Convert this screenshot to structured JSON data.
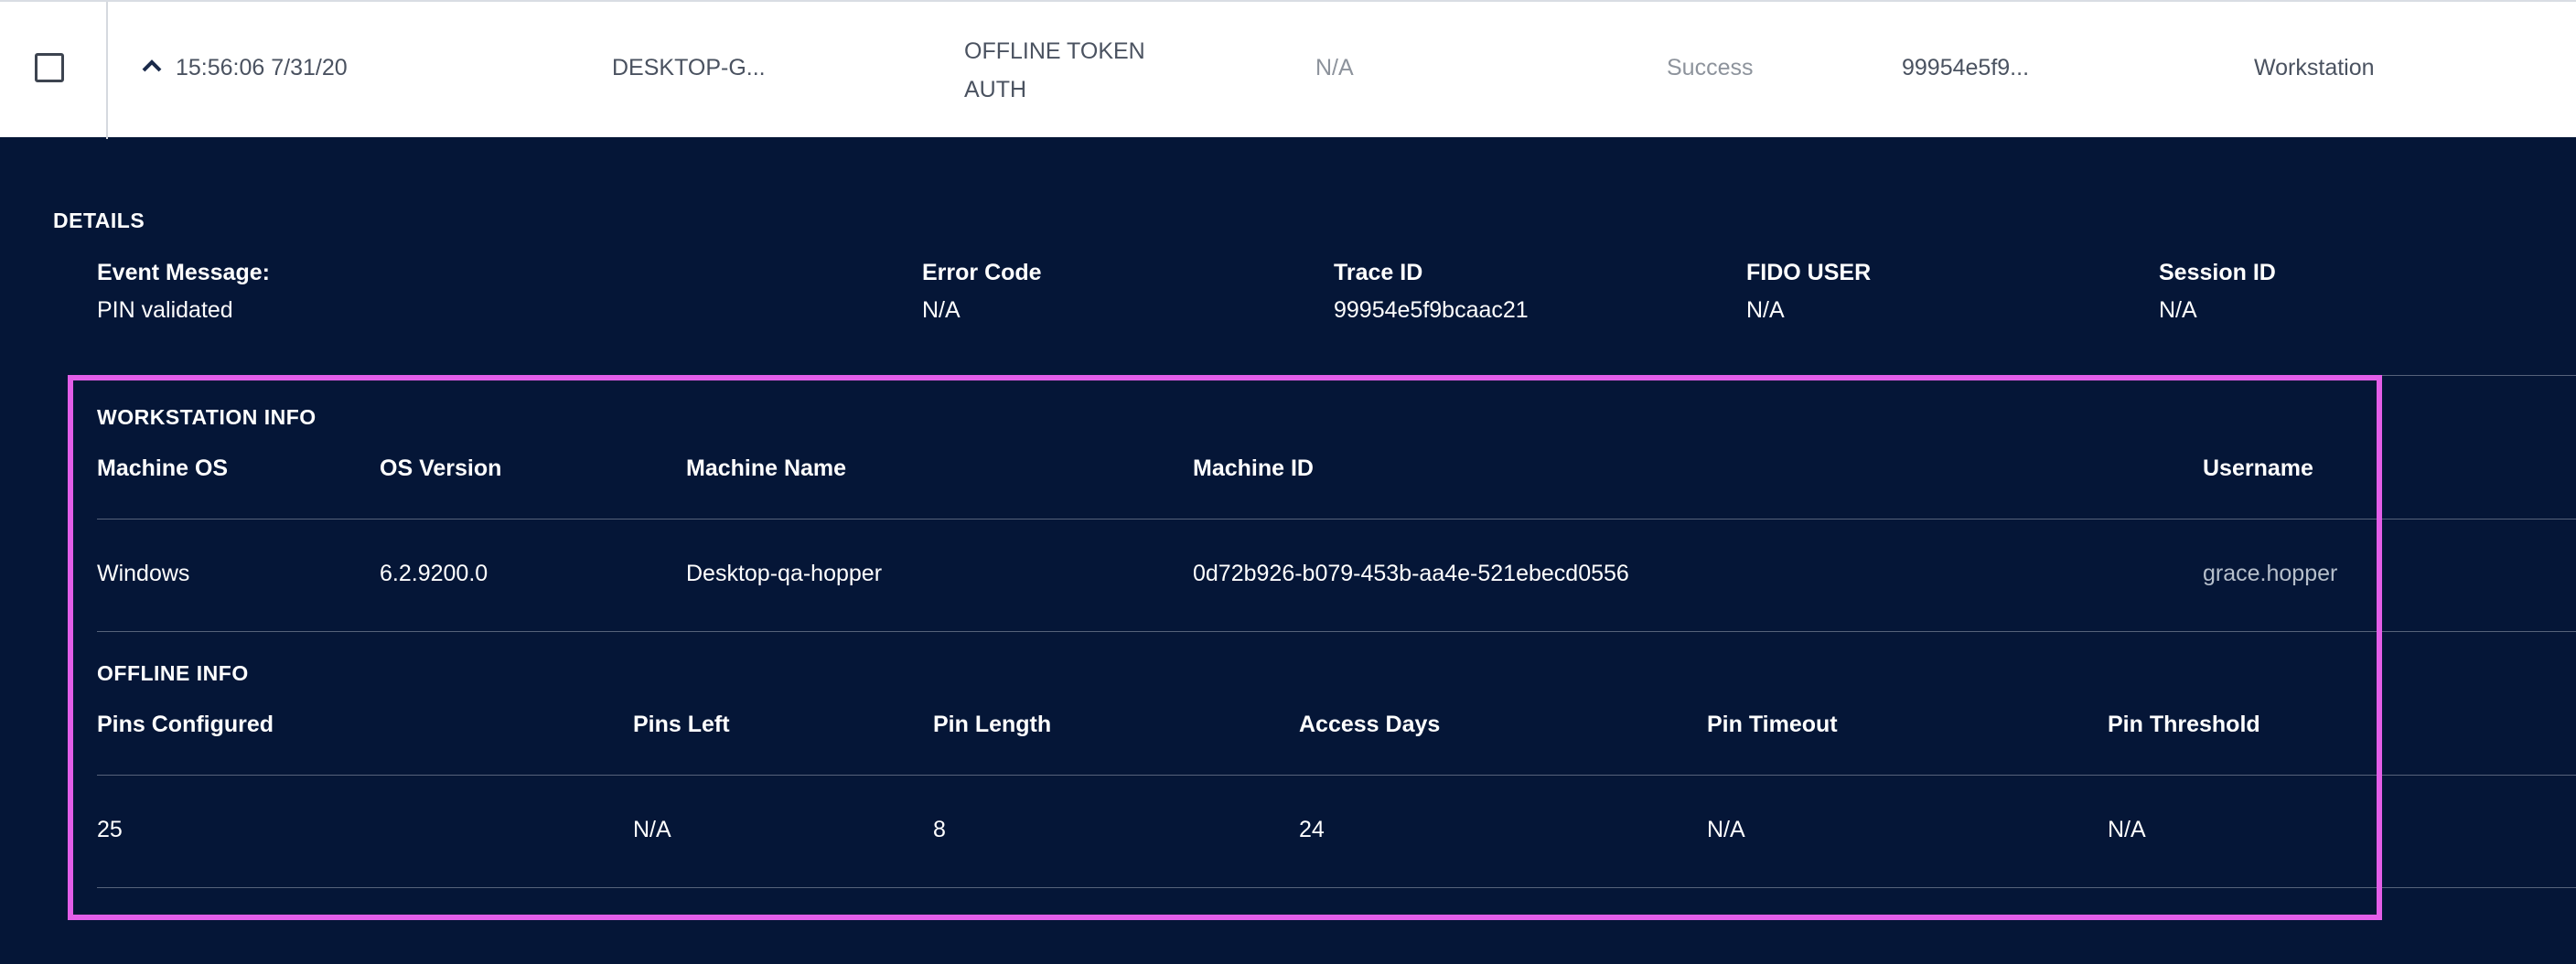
{
  "log_row": {
    "time": "15:56:06 7/31/20",
    "machine": "DESKTOP-G...",
    "event_line1": "OFFLINE TOKEN",
    "event_line2": "AUTH",
    "user": "N/A",
    "status": "Success",
    "trace": "99954e5f9...",
    "source": "Workstation"
  },
  "details": {
    "title": "DETAILS",
    "event_message_label": "Event Message:",
    "event_message_value": "PIN validated",
    "error_code_label": "Error Code",
    "error_code_value": "N/A",
    "trace_id_label": "Trace ID",
    "trace_id_value": "99954e5f9bcaac21",
    "fido_user_label": "FIDO USER",
    "fido_user_value": "N/A",
    "session_id_label": "Session ID",
    "session_id_value": "N/A"
  },
  "workstation_info": {
    "title": "WORKSTATION INFO",
    "headers": [
      "Machine OS",
      "OS Version",
      "Machine Name",
      "Machine ID",
      "Username"
    ],
    "values": [
      "Windows",
      "6.2.9200.0",
      "Desktop-qa-hopper",
      "0d72b926-b079-453b-aa4e-521ebecd0556",
      "grace.hopper"
    ]
  },
  "offline_info": {
    "title": "OFFLINE INFO",
    "headers": [
      "Pins Configured",
      "Pins Left",
      "Pin Length",
      "Access Days",
      "Pin Timeout",
      "Pin Threshold"
    ],
    "values": [
      "25",
      "N/A",
      "8",
      "24",
      "N/A",
      "N/A"
    ]
  },
  "colors": {
    "panel_bg": "#051637",
    "row_bg": "#ffffff",
    "highlight": "#e35ee8"
  },
  "icons": {
    "checkbox": "checkbox-icon",
    "expand": "chevron-up-icon"
  }
}
